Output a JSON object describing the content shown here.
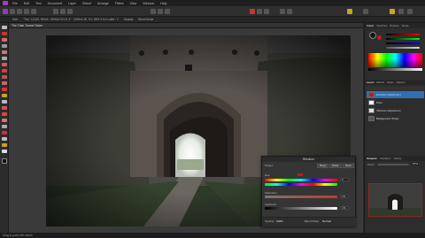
{
  "menu": [
    "File",
    "Edit",
    "Text",
    "Document",
    "Layer",
    "Select",
    "Arrange",
    "Filters",
    "View",
    "Window",
    "Help"
  ],
  "toolbar": {
    "doc_info": "\"Toe, 1,1000, 900x9 - 5000x1741.9, 4\" · 2000x1.90, 9.0, 86% 4 ft.d Label : 0"
  },
  "context": {
    "label1": "Size",
    "label2": "Opacity",
    "label3": "Blend Mode",
    "label4": "Curvature"
  },
  "document": {
    "tab_title": "The Train Tunnel Tuber"
  },
  "status": {
    "text": "Drag to paint with brush"
  },
  "panels": {
    "top_tabs": [
      "Colour",
      "Swatches",
      "Brushes",
      "Stroke"
    ],
    "layer_tabs": [
      "Layers",
      "Effects",
      "Styles",
      "Adjustm"
    ],
    "layers": [
      {
        "name": "Recolour Adjustment",
        "selected": true
      },
      {
        "name": "Pixel"
      },
      {
        "name": "Vibrance Adjustment"
      },
      {
        "name": "Background (Pixel)"
      }
    ],
    "nav_tabs": [
      "Navigator",
      "Transform",
      "History"
    ],
    "zoom_label": "Zoom",
    "zoom_value": "67%"
  },
  "adjustment": {
    "title": "Recolour",
    "preset_label": "Preset:",
    "merge_label": "Merge",
    "delete_label": "Delete",
    "reset_label": "Reset",
    "hue_label": "Hue",
    "hue_value": "0",
    "saturation_label": "Saturation",
    "saturation_value": "0 %",
    "lightness_label": "Lightness",
    "lightness_value": "0 %",
    "opacity_label": "Opacity:",
    "opacity_value": "100%",
    "blend_label": "Blend Mode:",
    "blend_value": "Normal"
  },
  "colors": {
    "accent": "#2f6fb5",
    "swatch_red": "#c21b1b"
  }
}
